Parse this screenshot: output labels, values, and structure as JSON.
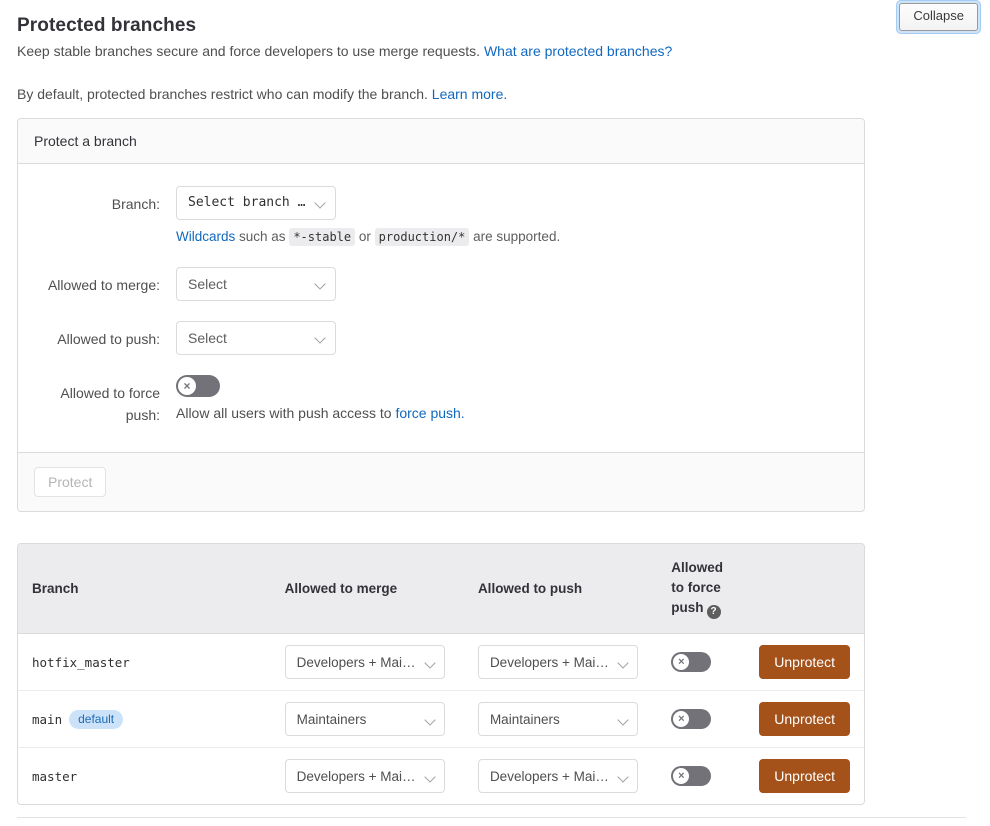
{
  "header": {
    "title": "Protected branches",
    "collapse_label": "Collapse",
    "lead_text_1": "Keep stable branches secure and force developers to use merge requests.",
    "lead_link_1": "What are protected branches?",
    "lead_text_2": "By default, protected branches restrict who can modify the branch.",
    "lead_link_2": "Learn more."
  },
  "card": {
    "header_title": "Protect a branch",
    "branch_label": "Branch:",
    "branch_select_value": "Select branch …",
    "wildcard_link": "Wildcards",
    "wildcard_text_1": "such as",
    "wildcard_code_1": "*-stable",
    "wildcard_text_2": "or",
    "wildcard_code_2": "production/*",
    "wildcard_text_3": "are supported.",
    "merge_label": "Allowed to merge:",
    "merge_select_value": "Select",
    "push_label": "Allowed to push:",
    "push_select_value": "Select",
    "force_push_label": "Allowed to force push:",
    "force_push_state": "off",
    "force_note_text": "Allow all users with push access to",
    "force_note_link": "force push.",
    "protect_button": "Protect"
  },
  "table": {
    "columns": {
      "branch": "Branch",
      "merge": "Allowed to merge",
      "push": "Allowed to push",
      "force_line1": "Allowed",
      "force_line2": "to force",
      "force_line3": "push",
      "force_help_icon": "question-mark-icon"
    },
    "rows": [
      {
        "branch": "hotfix_master",
        "badge": "",
        "merge": "Developers + Mai…",
        "push": "Developers + Mai…",
        "force_push": "off",
        "action": "Unprotect"
      },
      {
        "branch": "main",
        "badge": "default",
        "merge": "Maintainers",
        "push": "Maintainers",
        "force_push": "off",
        "action": "Unprotect"
      },
      {
        "branch": "master",
        "badge": "",
        "merge": "Developers + Mai…",
        "push": "Developers + Mai…",
        "force_push": "off",
        "action": "Unprotect"
      }
    ]
  },
  "colors": {
    "link": "#1068bf",
    "unprotect": "#a4521a",
    "badge_bg": "#cbe2f9",
    "badge_text": "#1f6bb5",
    "toggle_off": "#737278",
    "card_border": "#dbdbdb",
    "header_bg": "#ececef"
  }
}
